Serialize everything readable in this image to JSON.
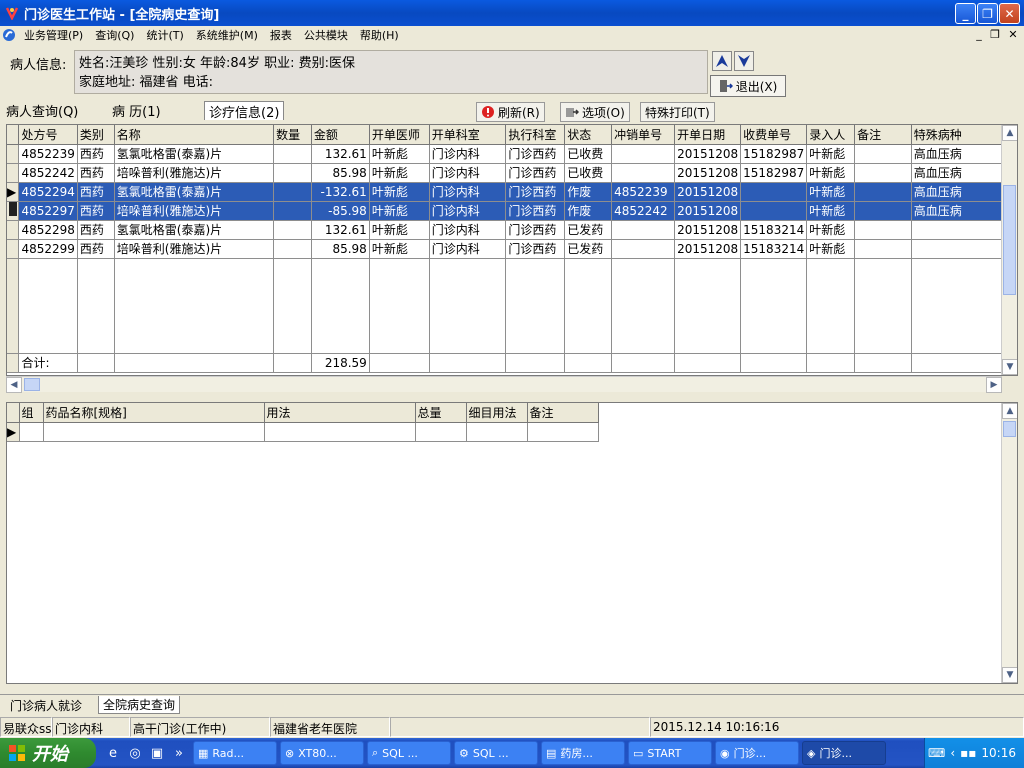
{
  "window": {
    "title": "门诊医生工作站 - [全院病史查询]"
  },
  "menu": [
    "业务管理(P)",
    "查询(Q)",
    "统计(T)",
    "系统维护(M)",
    "报表",
    "公共模块",
    "帮助(H)"
  ],
  "patient": {
    "label": "病人信息:",
    "line1": "姓名:汪美珍 性别:女 年龄:84岁  职业: 费别:医保",
    "line2": "家庭地址: 福建省 电话:",
    "exit_label": "退出(X)"
  },
  "tabs": [
    "病人查询(Q)",
    "病  历(1)",
    "诊疗信息(2)"
  ],
  "toolbar": {
    "refresh": "刷新(R)",
    "options": "选项(O)",
    "print": "特殊打印(T)"
  },
  "grid1": {
    "headers": [
      "处方号",
      "类别",
      "名称",
      "数量",
      "金额",
      "开单医师",
      "开单科室",
      "执行科室",
      "状态",
      "冲销单号",
      "开单日期",
      "收费单号",
      "录入人",
      "备注",
      "特殊病种"
    ],
    "rows": [
      [
        "4852239",
        "西药",
        "氢氯吡格雷(泰嘉)片",
        "",
        "132.61",
        "叶新彪",
        "门诊内科",
        "门诊西药",
        "已收费",
        "",
        "20151208",
        "15182987",
        "叶新彪",
        "",
        "高血压病"
      ],
      [
        "4852242",
        "西药",
        "培哚普利(雅施达)片",
        "",
        "85.98",
        "叶新彪",
        "门诊内科",
        "门诊西药",
        "已收费",
        "",
        "20151208",
        "15182987",
        "叶新彪",
        "",
        "高血压病"
      ],
      [
        "4852294",
        "西药",
        "氢氯吡格雷(泰嘉)片",
        "",
        "-132.61",
        "叶新彪",
        "门诊内科",
        "门诊西药",
        "作废",
        "4852239",
        "20151208",
        "",
        "叶新彪",
        "",
        "高血压病"
      ],
      [
        "4852297",
        "西药",
        "培哚普利(雅施达)片",
        "",
        "-85.98",
        "叶新彪",
        "门诊内科",
        "门诊西药",
        "作废",
        "4852242",
        "20151208",
        "",
        "叶新彪",
        "",
        "高血压病"
      ],
      [
        "4852298",
        "西药",
        "氢氯吡格雷(泰嘉)片",
        "",
        "132.61",
        "叶新彪",
        "门诊内科",
        "门诊西药",
        "已发药",
        "",
        "20151208",
        "15183214",
        "叶新彪",
        "",
        ""
      ],
      [
        "4852299",
        "西药",
        "培哚普利(雅施达)片",
        "",
        "85.98",
        "叶新彪",
        "门诊内科",
        "门诊西药",
        "已发药",
        "",
        "20151208",
        "15183214",
        "叶新彪",
        "",
        ""
      ]
    ],
    "total_label": "合计:",
    "total_value": "218.59"
  },
  "grid2": {
    "headers": [
      "组",
      "药品名称[规格]",
      "用法",
      "总量",
      "细目用法",
      "备注"
    ]
  },
  "bottom_tabs": [
    "门诊病人就诊",
    "全院病史查询"
  ],
  "status": {
    "user": "易联众ss",
    "dept": "门诊内科",
    "mode": "高干门诊(工作中)",
    "hospital": "福建省老年医院",
    "datetime": "2015.12.14 10:16:16"
  },
  "taskbar": {
    "start": "开始",
    "tasks": [
      "Rad...",
      "XT80...",
      "SQL ...",
      "SQL ...",
      "药房...",
      "START",
      "门诊...",
      "门诊..."
    ],
    "clock": "10:16"
  }
}
